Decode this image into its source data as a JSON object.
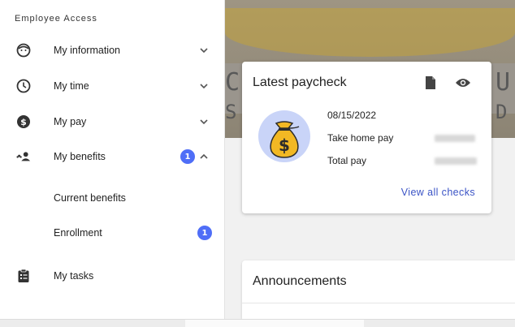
{
  "sidebar": {
    "section_title": "Employee Access",
    "items": [
      {
        "label": "My information",
        "icon": "face-icon"
      },
      {
        "label": "My time",
        "icon": "clock-icon"
      },
      {
        "label": "My pay",
        "icon": "dollar-icon"
      },
      {
        "label": "My benefits",
        "icon": "people-icon",
        "badge": "1"
      },
      {
        "label": "My tasks",
        "icon": "clipboard-icon"
      }
    ],
    "sub_items": [
      {
        "label": "Current benefits"
      },
      {
        "label": "Enrollment",
        "badge": "1"
      }
    ]
  },
  "paycheck": {
    "title": "Latest paycheck",
    "date": "08/15/2022",
    "take_home_label": "Take home pay",
    "total_pay_label": "Total pay",
    "view_all": "View all checks"
  },
  "announcements": {
    "title": "Announcements"
  },
  "colors": {
    "accent": "#4f6ef7",
    "link": "#3b54c6",
    "bag_gold": "#f2b824",
    "bag_circle": "#c9d4f8"
  }
}
